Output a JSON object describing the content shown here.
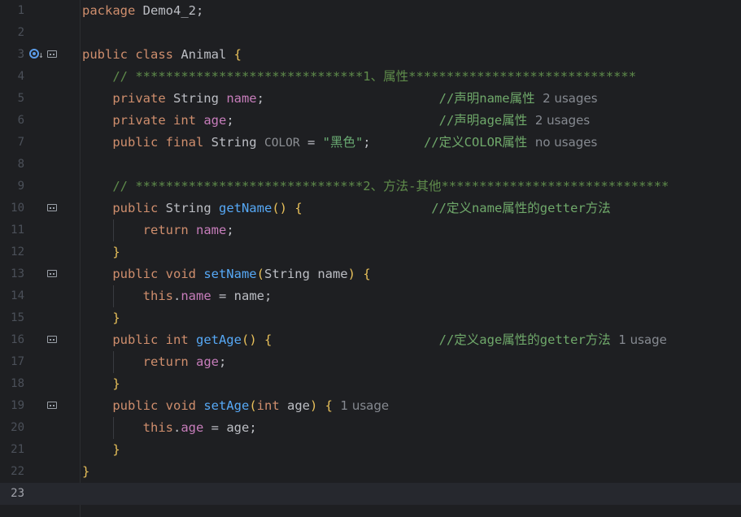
{
  "editor": {
    "lines": [
      {
        "n": "1",
        "tokens": [
          [
            "kw",
            "package "
          ],
          [
            "plain",
            "Demo4_2;"
          ]
        ]
      },
      {
        "n": "2",
        "tokens": []
      },
      {
        "n": "3",
        "tokens": [
          [
            "kw",
            "public class "
          ],
          [
            "plain",
            "Animal "
          ],
          [
            "brace",
            "{"
          ]
        ]
      },
      {
        "n": "4",
        "tokens": [
          [
            "cmt",
            "    // ******************************1、属性******************************"
          ]
        ]
      },
      {
        "n": "5",
        "tokens": [
          [
            "kw",
            "    private "
          ],
          [
            "ty",
            "String "
          ],
          [
            "fld",
            "name"
          ],
          [
            "plain",
            ";                       "
          ],
          [
            "cmtg",
            "//声明name属性"
          ],
          [
            "hint",
            "  2 usages"
          ]
        ]
      },
      {
        "n": "6",
        "tokens": [
          [
            "kw",
            "    private int "
          ],
          [
            "fld",
            "age"
          ],
          [
            "plain",
            ";                           "
          ],
          [
            "cmtg",
            "//声明age属性"
          ],
          [
            "hint",
            "  2 usages"
          ]
        ]
      },
      {
        "n": "7",
        "tokens": [
          [
            "kw",
            "    public final "
          ],
          [
            "ty",
            "String "
          ],
          [
            "const",
            "COLOR"
          ],
          [
            "plain",
            " = "
          ],
          [
            "str",
            "\"黑色\""
          ],
          [
            "plain",
            ";       "
          ],
          [
            "cmtg",
            "//定义COLOR属性"
          ],
          [
            "hint",
            "  no usages"
          ]
        ]
      },
      {
        "n": "8",
        "tokens": []
      },
      {
        "n": "9",
        "tokens": [
          [
            "cmt",
            "    // ******************************2、方法-其他******************************"
          ]
        ]
      },
      {
        "n": "10",
        "tokens": [
          [
            "kw",
            "    public "
          ],
          [
            "ty",
            "String "
          ],
          [
            "fn",
            "getName"
          ],
          [
            "paren",
            "() "
          ],
          [
            "brace",
            "{"
          ],
          [
            "plain",
            "                 "
          ],
          [
            "cmtg",
            "//定义name属性的getter方法"
          ]
        ]
      },
      {
        "n": "11",
        "tokens": [
          [
            "kw",
            "        return "
          ],
          [
            "fld",
            "name"
          ],
          [
            "plain",
            ";"
          ]
        ]
      },
      {
        "n": "12",
        "tokens": [
          [
            "brace",
            "    }"
          ]
        ]
      },
      {
        "n": "13",
        "tokens": [
          [
            "kw",
            "    public void "
          ],
          [
            "fn",
            "setName"
          ],
          [
            "paren",
            "("
          ],
          [
            "ty",
            "String "
          ],
          [
            "plain",
            "name"
          ],
          [
            "paren",
            ") "
          ],
          [
            "brace",
            "{"
          ]
        ]
      },
      {
        "n": "14",
        "tokens": [
          [
            "kw",
            "        this"
          ],
          [
            "plain",
            "."
          ],
          [
            "fld",
            "name"
          ],
          [
            "plain",
            " = name;"
          ]
        ]
      },
      {
        "n": "15",
        "tokens": [
          [
            "brace",
            "    }"
          ]
        ]
      },
      {
        "n": "16",
        "tokens": [
          [
            "kw",
            "    public int "
          ],
          [
            "fn",
            "getAge"
          ],
          [
            "paren",
            "() "
          ],
          [
            "brace",
            "{"
          ],
          [
            "plain",
            "                      "
          ],
          [
            "cmtg",
            "//定义age属性的getter方法"
          ],
          [
            "hint",
            "  1 usage"
          ]
        ]
      },
      {
        "n": "17",
        "tokens": [
          [
            "kw",
            "        return "
          ],
          [
            "fld",
            "age"
          ],
          [
            "plain",
            ";"
          ]
        ]
      },
      {
        "n": "18",
        "tokens": [
          [
            "brace",
            "    }"
          ]
        ]
      },
      {
        "n": "19",
        "tokens": [
          [
            "kw",
            "    public void "
          ],
          [
            "fn",
            "setAge"
          ],
          [
            "paren",
            "("
          ],
          [
            "kw",
            "int "
          ],
          [
            "plain",
            "age"
          ],
          [
            "paren",
            ") "
          ],
          [
            "brace",
            "{"
          ],
          [
            "hint",
            "  1 usage"
          ]
        ]
      },
      {
        "n": "20",
        "tokens": [
          [
            "kw",
            "        this"
          ],
          [
            "plain",
            "."
          ],
          [
            "fld",
            "age"
          ],
          [
            "plain",
            " = age;"
          ]
        ]
      },
      {
        "n": "21",
        "tokens": [
          [
            "brace",
            "    }"
          ]
        ]
      },
      {
        "n": "22",
        "tokens": [
          [
            "brace",
            "}"
          ]
        ]
      },
      {
        "n": "23",
        "tokens": []
      }
    ],
    "current_line": "23",
    "fold_lines": [
      "3",
      "10",
      "13",
      "16",
      "19"
    ],
    "implemented_marker_line": "3"
  },
  "colors": {
    "background": "#1e1f22",
    "keyword": "#cf8e6d",
    "field": "#c77dbb",
    "function": "#56a8f5",
    "string": "#6aab73",
    "comment": "#5f8c4b",
    "brace": "#e8c05a",
    "hint": "#868a91"
  }
}
